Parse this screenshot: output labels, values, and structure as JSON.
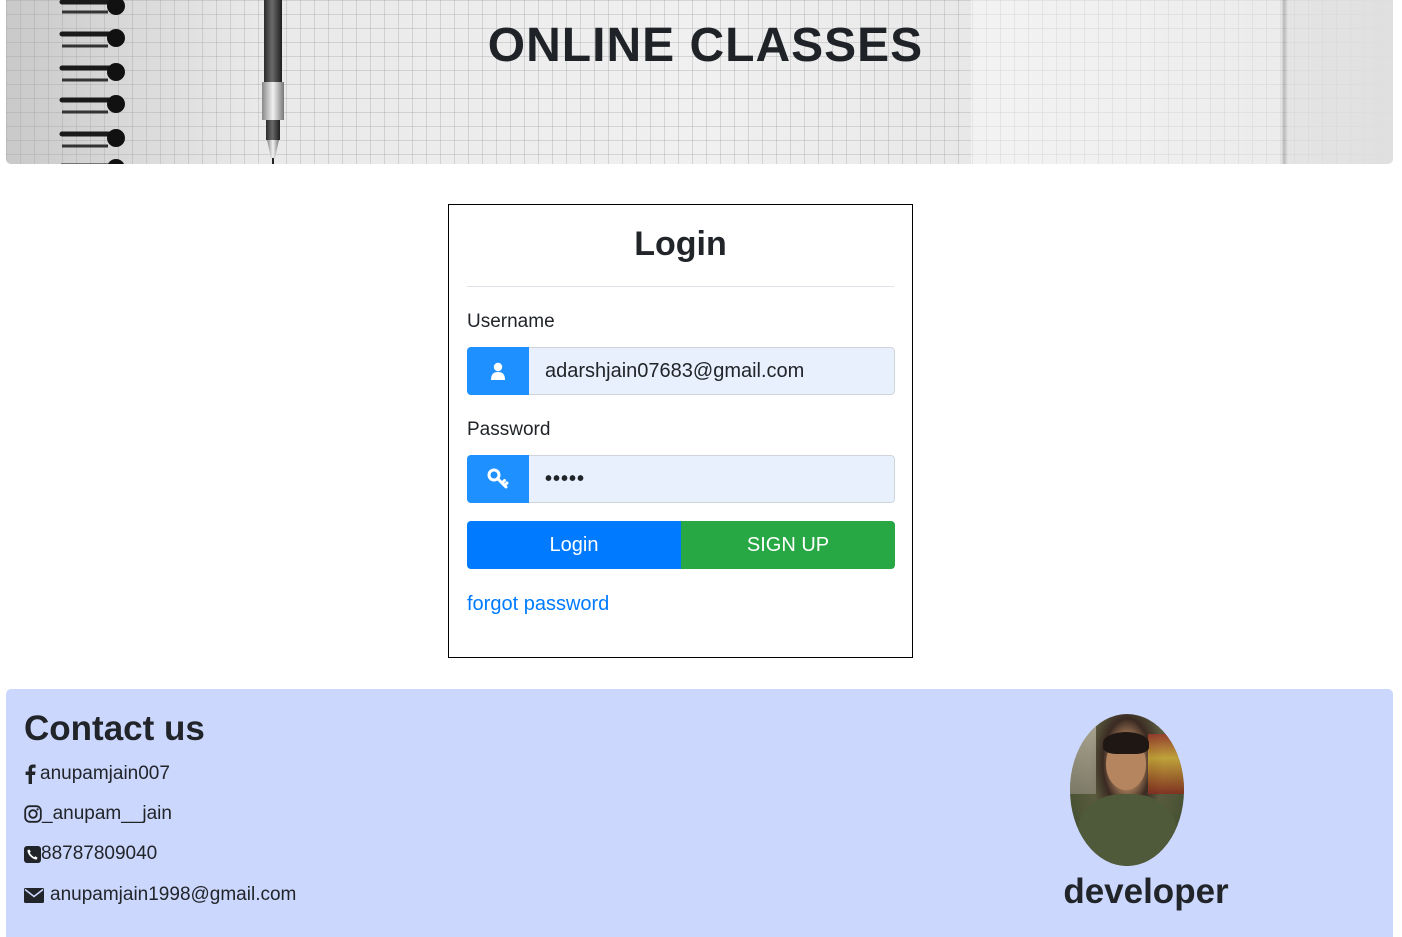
{
  "banner": {
    "title": "ONLINE CLASSES"
  },
  "login": {
    "title": "Login",
    "username_label": "Username",
    "username_value": "adarshjain07683@gmail.com",
    "password_label": "Password",
    "password_value": "•••••",
    "login_button": "Login",
    "signup_button": "SIGN UP",
    "forgot_link": "forgot password",
    "icons": {
      "username": "user-icon",
      "password": "key-icon"
    }
  },
  "footer": {
    "contact_title": "Contact us",
    "items": [
      {
        "icon": "facebook-icon",
        "text": "anupamjain007"
      },
      {
        "icon": "instagram-icon",
        "text": "_anupam__jain"
      },
      {
        "icon": "phone-icon",
        "text": "88787809040"
      },
      {
        "icon": "envelope-icon",
        "text": "anupamjain1998@gmail.com"
      }
    ],
    "developer_label": "developer"
  },
  "colors": {
    "primary": "#007bff",
    "success": "#28a745",
    "icon_bg": "#1e90ff",
    "input_bg": "#e8f0fe",
    "footer_bg": "#ccd7fd"
  }
}
